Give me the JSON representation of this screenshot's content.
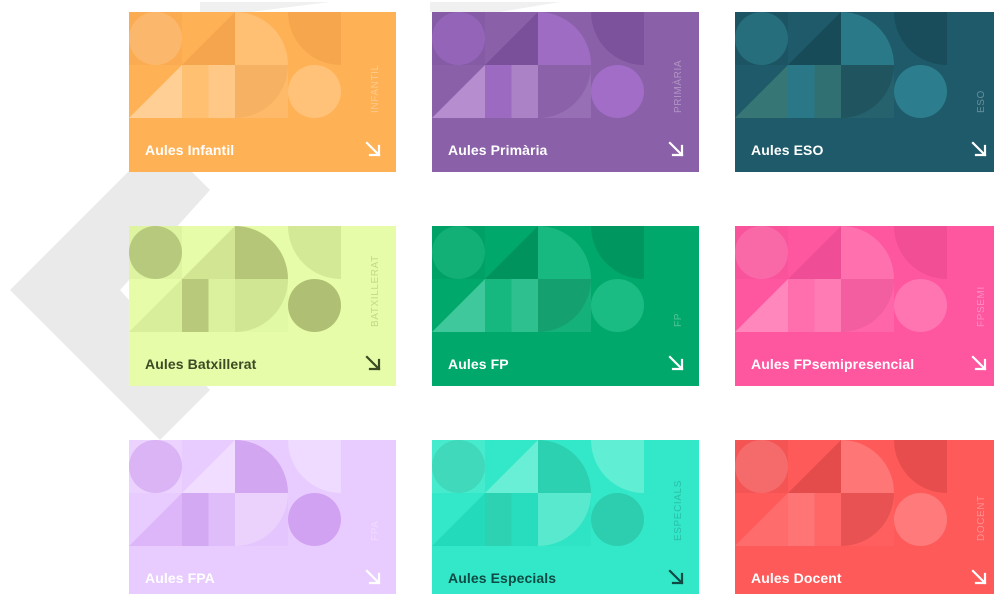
{
  "cards": [
    {
      "title": "Aules Infantil",
      "vlabel": "INFANTIL",
      "bg": "#ffb155",
      "fg": "#ffffff",
      "shade1": "#ffc67f",
      "shade2": "#f0a04a",
      "shade3": "#ffd7a6"
    },
    {
      "title": "Aules Primària",
      "vlabel": "PRIMÀRIA",
      "bg": "#8a60a8",
      "fg": "#ffffff",
      "shade1": "#a470cc",
      "shade2": "#744a96",
      "shade3": "#c09ad8"
    },
    {
      "title": "Aules ESO",
      "vlabel": "ESO",
      "bg": "#1e5a6a",
      "fg": "#ffffff",
      "shade1": "#2f8494",
      "shade2": "#164451",
      "shade3": "#3c7d78"
    },
    {
      "title": "Aules Batxillerat",
      "vlabel": "BATXILLERAT",
      "bg": "#e6fca8",
      "fg": "#3d4a24",
      "shade1": "#a4b46a",
      "shade2": "#c8dc8a",
      "shade3": "#d4ea96"
    },
    {
      "title": "Aules FP",
      "vlabel": "FP",
      "bg": "#00a86b",
      "fg": "#ffffff",
      "shade1": "#1fbf88",
      "shade2": "#008a58",
      "shade3": "#4fd0a8"
    },
    {
      "title": "Aules FPsemipresencial",
      "vlabel": "FPSEMI",
      "bg": "#ff56a0",
      "fg": "#ffffff",
      "shade1": "#ff7ab4",
      "shade2": "#e84a90",
      "shade3": "#ff94c2"
    },
    {
      "title": "Aules FPA",
      "vlabel": "FPA",
      "bg": "#e8ccff",
      "fg": "#ffffff",
      "shade1": "#cc9aee",
      "shade2": "#f4e4ff",
      "shade3": "#d8b0f6"
    },
    {
      "title": "Aules Especials",
      "vlabel": "ESPECIALS",
      "bg": "#33e8c8",
      "fg": "#0f4a44",
      "shade1": "#2bc9aa",
      "shade2": "#7ff2dc",
      "shade3": "#1fd6b6"
    },
    {
      "title": "Aules Docent",
      "vlabel": "DOCENT",
      "bg": "#ff5a5a",
      "fg": "#ffffff",
      "shade1": "#ff8080",
      "shade2": "#d84444",
      "shade3": "#ff7070"
    }
  ],
  "icons": {
    "arrow": "arrow-down-right-icon"
  }
}
